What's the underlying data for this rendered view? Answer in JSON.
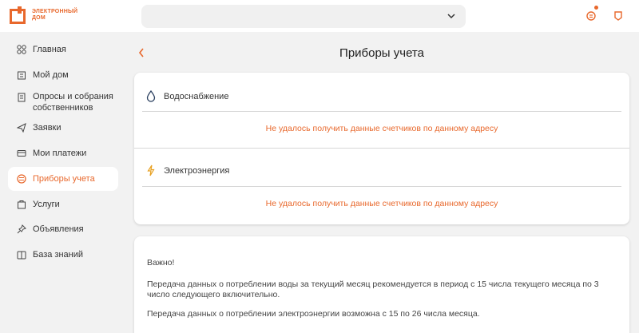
{
  "header": {
    "logo_text": "ЭЛЕКТРОННЫЙ ДОМ",
    "address_value": ""
  },
  "sidebar": {
    "items": [
      {
        "label": "Главная",
        "icon": "home-grid-icon"
      },
      {
        "label": "Мой дом",
        "icon": "building-icon"
      },
      {
        "label": "Опросы и собрания собственников",
        "icon": "survey-icon"
      },
      {
        "label": "Заявки",
        "icon": "paper-plane-icon"
      },
      {
        "label": "Мои платежи",
        "icon": "wallet-icon"
      },
      {
        "label": "Приборы учета",
        "icon": "meter-icon",
        "active": true
      },
      {
        "label": "Услуги",
        "icon": "services-icon"
      },
      {
        "label": "Объявления",
        "icon": "pushpin-icon"
      },
      {
        "label": "База знаний",
        "icon": "book-icon"
      }
    ]
  },
  "main": {
    "title": "Приборы учета",
    "sections": [
      {
        "title": "Водоснабжение",
        "icon": "water-drop-icon",
        "error": "Не удалось получить данные счетчиков по данному адресу"
      },
      {
        "title": "Электроэнергия",
        "icon": "lightning-icon",
        "error": "Не удалось получить данные счетчиков по данному адресу"
      }
    ],
    "info": {
      "heading": "Важно!",
      "p1": "Передача данных о потреблении воды за текущий месяц рекомендуется в период с 15 числа текущего месяца по 3 число следующего включительно.",
      "p2": "Передача данных о потреблении электроэнергии возможна с 15 по 26 числа месяца."
    }
  },
  "colors": {
    "accent": "#e8682c",
    "background": "#f2f2f2",
    "card": "#ffffff"
  }
}
